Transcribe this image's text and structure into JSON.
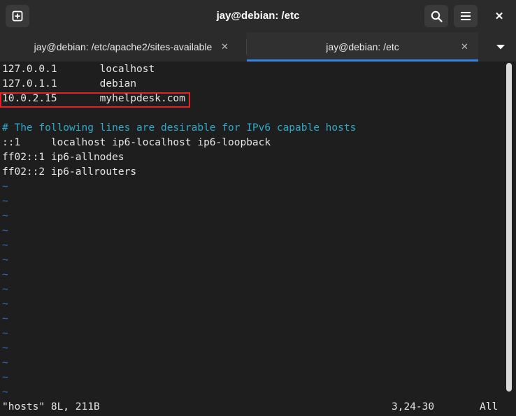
{
  "window": {
    "title": "jay@debian: /etc",
    "icons": {
      "new_tab": "new-tab-icon",
      "search": "search-icon",
      "menu": "hamburger-menu-icon",
      "close": "close-icon",
      "tabs_menu": "chevron-down-icon"
    },
    "close_glyph": "✕"
  },
  "tabs": [
    {
      "label": "jay@debian: /etc/apache2/sites-available",
      "close_glyph": "✕",
      "active": false
    },
    {
      "label": "jay@debian: /etc",
      "close_glyph": "✕",
      "active": true
    }
  ],
  "editor": {
    "lines": [
      "127.0.0.1       localhost",
      "127.0.1.1       debian",
      "10.0.2.15       myhelpdesk.com",
      "",
      "# The following lines are desirable for IPv6 capable hosts",
      "::1     localhost ip6-localhost ip6-loopback",
      "ff02::1 ip6-allnodes",
      "ff02::2 ip6-allrouters"
    ],
    "tilde": "~",
    "status": {
      "file": "\"hosts\" 8L, 211B",
      "position": "3,24-30",
      "scroll": "All"
    }
  },
  "colors": {
    "background": "#1e1e1e",
    "comment": "#2ea9c9",
    "tilde": "#2f6fb7",
    "highlight_border": "#e0242a",
    "active_tab_underline": "#3584e4"
  }
}
